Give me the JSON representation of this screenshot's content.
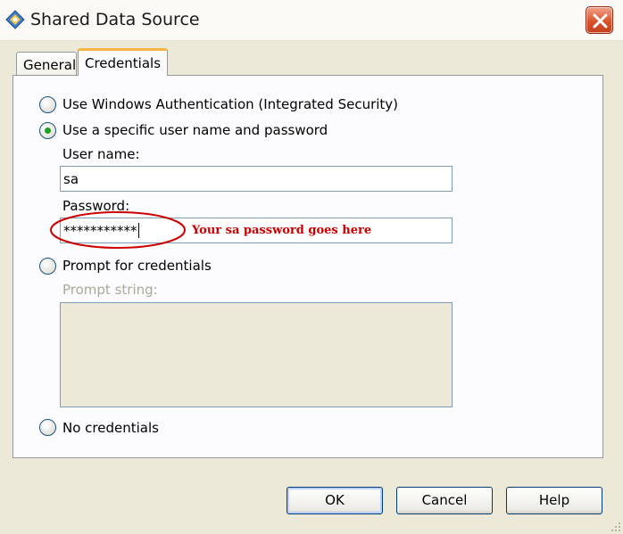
{
  "window": {
    "title": "Shared Data Source",
    "app_icon": "data-source-icon",
    "close_icon": "close-icon"
  },
  "tabs": [
    {
      "label": "General",
      "selected": false
    },
    {
      "label": "Credentials",
      "selected": true
    }
  ],
  "credentials": {
    "options": {
      "windows_auth": {
        "label": "Use Windows Authentication (Integrated Security)",
        "checked": false
      },
      "specific_user": {
        "label": "Use a specific user name and password",
        "checked": true
      },
      "prompt": {
        "label": "Prompt for credentials",
        "checked": false
      },
      "none": {
        "label": "No credentials",
        "checked": false
      }
    },
    "user_name": {
      "label": "User name:",
      "value": "sa"
    },
    "password": {
      "label": "Password:",
      "value": "***********"
    },
    "prompt_string": {
      "label": "Prompt string:",
      "value": ""
    }
  },
  "annotation": {
    "text": "Your sa password goes here",
    "color": "#CC0000"
  },
  "buttons": {
    "ok": "OK",
    "cancel": "Cancel",
    "help": "Help"
  },
  "colors": {
    "window_bg": "#ECE9D8",
    "tab_accent": "#F7B445",
    "radio_checked": "#21A121",
    "close_button": "#D9532E"
  }
}
